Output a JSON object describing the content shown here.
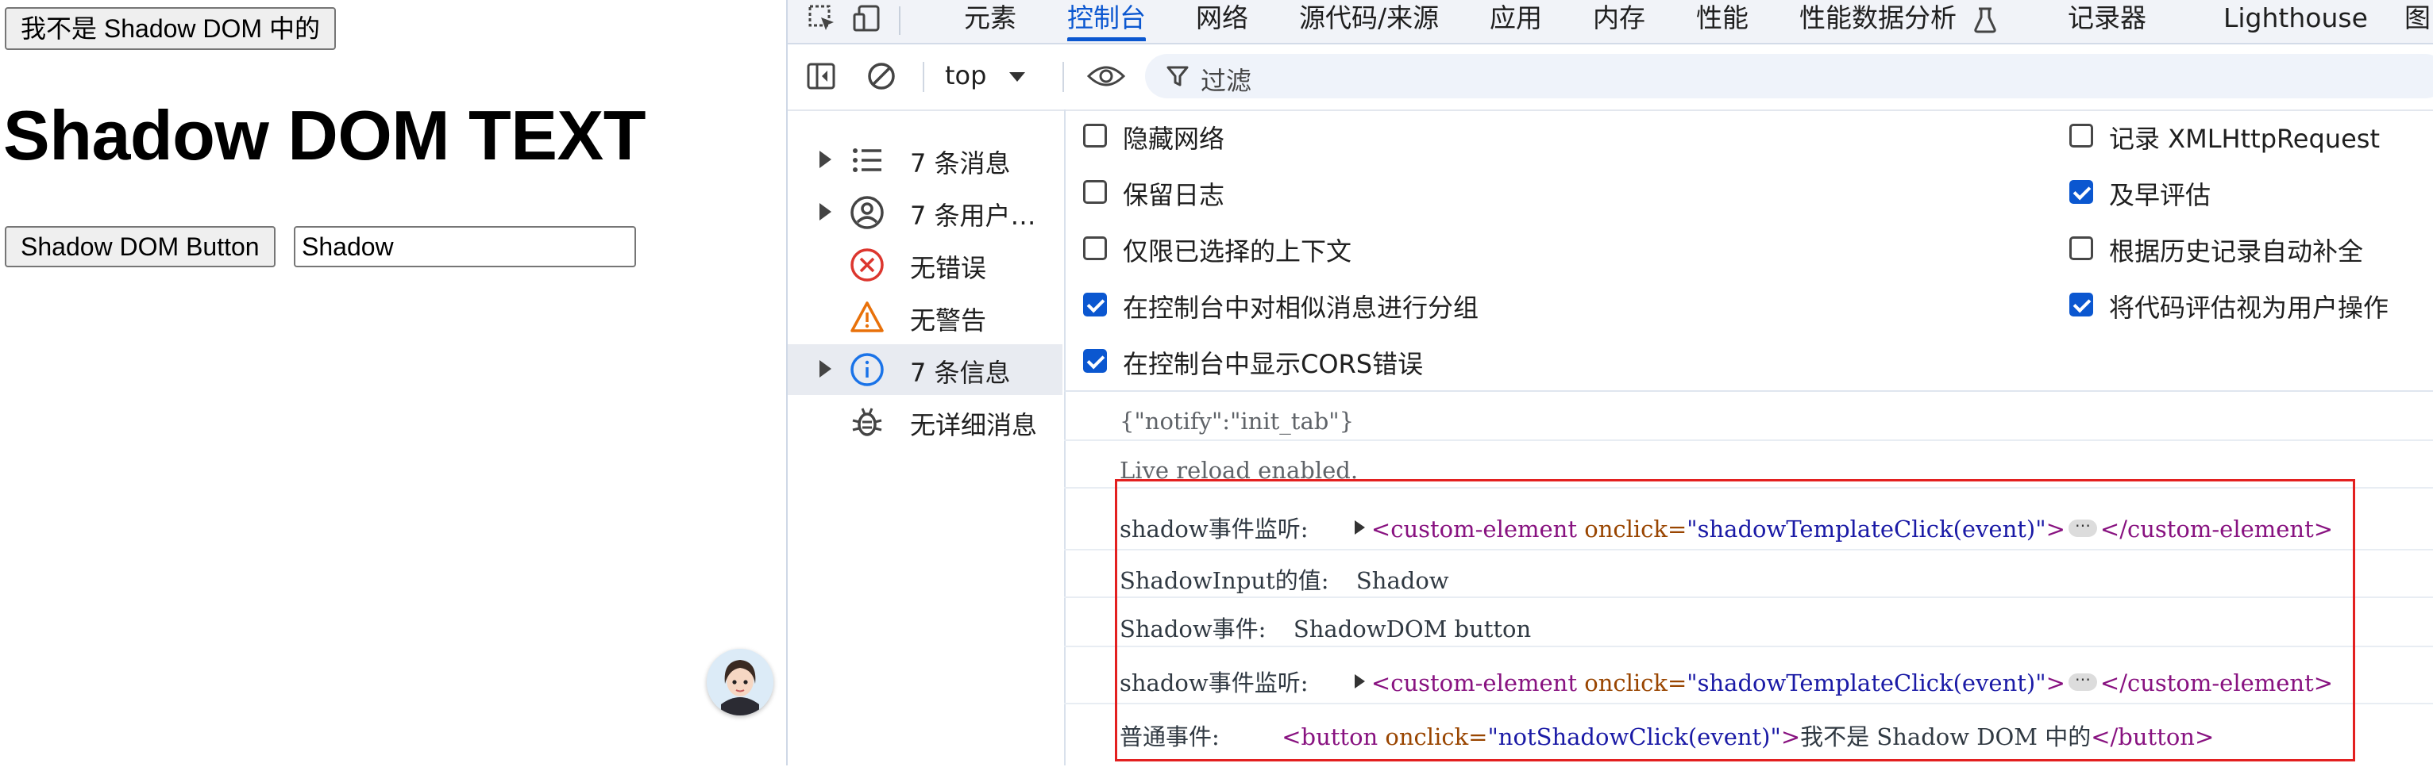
{
  "page": {
    "top_button": "我不是 Shadow DOM 中的",
    "heading": "Shadow DOM TEXT",
    "shadow_button": "Shadow DOM Button",
    "shadow_input_value": "Shadow"
  },
  "devtools": {
    "tabs": [
      "元素",
      "控制台",
      "网络",
      "源代码/来源",
      "应用",
      "内存",
      "性能",
      "性能数据分析",
      "记录器",
      "Lighthouse",
      "图"
    ],
    "active_tab": "控制台",
    "toolbar": {
      "context": "top",
      "filter_placeholder": "过滤"
    },
    "sidebar": [
      {
        "label": "7 条消息",
        "icon": "list-icon",
        "expandable": true
      },
      {
        "label": "7 条用户消...",
        "icon": "user-icon",
        "expandable": true
      },
      {
        "label": "无错误",
        "icon": "error-icon",
        "expandable": false
      },
      {
        "label": "无警告",
        "icon": "warning-icon",
        "expandable": false
      },
      {
        "label": "7 条信息",
        "icon": "info-icon",
        "expandable": true,
        "selected": true
      },
      {
        "label": "无详细消息",
        "icon": "bug-icon",
        "expandable": false
      }
    ],
    "settings_left": [
      {
        "label": "隐藏网络",
        "checked": false
      },
      {
        "label": "保留日志",
        "checked": false
      },
      {
        "label": "仅限已选择的上下文",
        "checked": false
      },
      {
        "label": "在控制台中对相似消息进行分组",
        "checked": true
      },
      {
        "label": "在控制台中显示CORS错误",
        "checked": true
      }
    ],
    "settings_right": [
      {
        "label": "记录 XMLHttpRequest",
        "checked": false
      },
      {
        "label": "及早评估",
        "checked": true
      },
      {
        "label": "根据历史记录自动补全",
        "checked": false
      },
      {
        "label": "将代码评估视为用户操作",
        "checked": true
      }
    ],
    "console": {
      "line1": "{\"notify\":\"init_tab\"}",
      "line2": "Live reload enabled.",
      "line3_prefix": "shadow事件监听:",
      "line4_prefix": "ShadowInput的值:",
      "line4_value": "Shadow",
      "line5_prefix": "Shadow事件:",
      "line5_value": "ShadowDOM button",
      "line6_prefix": "shadow事件监听:",
      "line7_prefix": "普通事件:",
      "tag_custom_open": "<custom-element",
      "attr_onclick": "onclick=",
      "custom_onclick_value": "\"shadowTemplateClick(event)\"",
      "tag_close_bracket": ">",
      "tag_custom_close": "</custom-element>",
      "tag_button_open": "<button",
      "button_onclick_value": "\"notShadowClick(event)\"",
      "button_text": "我不是 Shadow DOM 中的",
      "tag_button_close": "</button>",
      "ellipsis": "⋯"
    }
  },
  "colors": {
    "accent": "#0b57d0",
    "highlight": "#e32020",
    "tag": "#881280",
    "attr": "#994500",
    "value": "#1a1aa6"
  }
}
